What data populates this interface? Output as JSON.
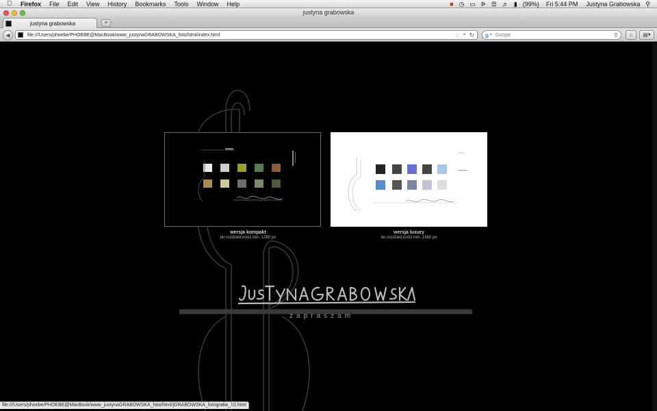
{
  "menubar": {
    "app": "Firefox",
    "menus": [
      "File",
      "Edit",
      "View",
      "History",
      "Bookmarks",
      "Tools",
      "Window",
      "Help"
    ],
    "battery": "(99%)",
    "clock": "Fri 5:44 PM",
    "user": "Justyna Grabowska",
    "icons": [
      "apple-icon",
      "wifi-icon",
      "volume-icon",
      "battery-icon",
      "spotlight-icon"
    ]
  },
  "window": {
    "title": "justyna grabowska"
  },
  "tab": {
    "label": "justyna grabowska",
    "new_tab": "+"
  },
  "navbar": {
    "url": "file:///Users/phoebe/PHOEBE@MacBook/www_justynaGRABOWSKA_foto/html/index.html",
    "search_placeholder": "Google",
    "search_engine": "g"
  },
  "page": {
    "options": [
      {
        "name": "wersja kompakt",
        "subtitle": "do rozdzielczości min. 1280 px"
      },
      {
        "name": "wersja luxury",
        "subtitle": "do rozdzielczości min. 1680 px"
      }
    ],
    "signature": "JUSTYNA GRABOWSKA",
    "welcome": "zapraszam"
  },
  "statusbar": {
    "text": "file:///Users/phoebe/PHOEBE@MacBook/www_justynaGRABOWSKA_foto/html/jGRABOWSKA_fotografia_10.html"
  },
  "colors": {
    "background": "#000000",
    "deco_stroke": "#3a3a3a",
    "signature": "#b8b8b8",
    "caption": "#cfcfcf"
  }
}
